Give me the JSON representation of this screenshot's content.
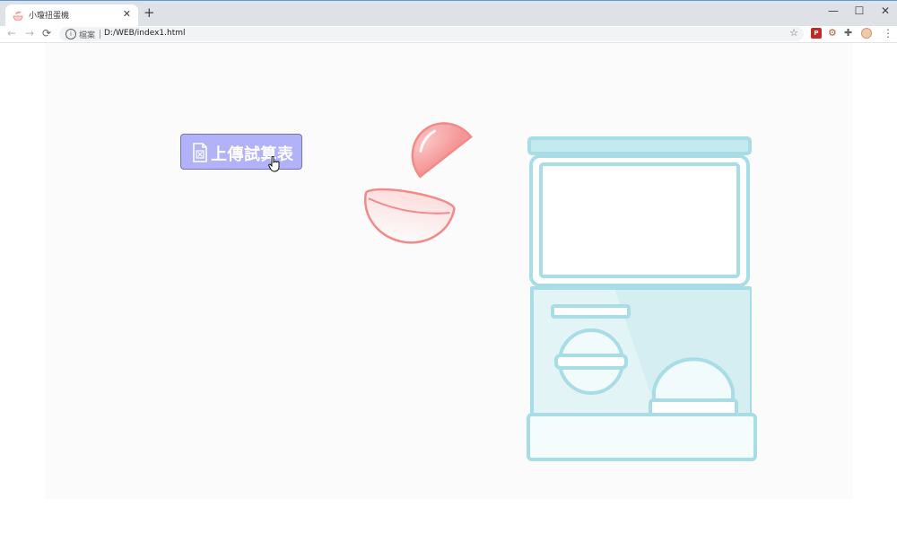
{
  "browser": {
    "tab": {
      "title": "小瓊扭蛋機",
      "close_glyph": "✕"
    },
    "new_tab_glyph": "+",
    "window_controls": {
      "minimize": "—",
      "maximize": "☐",
      "close": "✕"
    },
    "nav": {
      "back": "←",
      "forward": "→",
      "reload": "⟳"
    },
    "address": {
      "info_glyph": "i",
      "scheme_label": "檔案",
      "url": "D:/WEB/index1.html"
    },
    "icons": [
      "star-icon",
      "extension-red-icon",
      "extension-gear-icon",
      "extensions-puzzle-icon",
      "profile-avatar",
      "menu-dots-icon"
    ],
    "menu_glyph": "⋮"
  },
  "page": {
    "upload_button": {
      "label": "上傳試算表",
      "icon": "spreadsheet-file-icon"
    },
    "illustrations": [
      "capsule-open",
      "gashapon-machine"
    ]
  },
  "colors": {
    "button_bg": "#b1b2f7",
    "button_border": "#6f72c9",
    "capsule": "#f6a0a0",
    "machine_outline": "#a8dde5",
    "machine_fill": "#e6f5f7"
  }
}
